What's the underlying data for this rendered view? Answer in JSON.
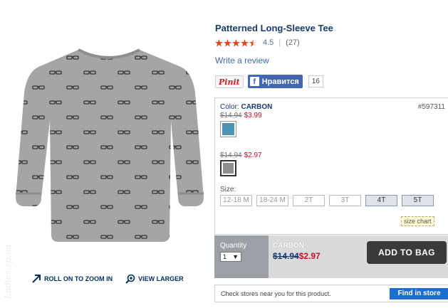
{
  "product": {
    "title": "Patterned Long-Sleeve Tee",
    "rating": "4.5",
    "review_count": "(27)",
    "rating_sep": "|",
    "write_review": "Write a review"
  },
  "social": {
    "pinit": "Pinit",
    "fb_icon": "f",
    "fb_like": "Нравится",
    "fb_count": "16"
  },
  "options": {
    "color_prefix": "Color:",
    "color_name": "CARBON",
    "sku": "#597311",
    "variant1": {
      "old_price": "$14.94",
      "new_price": "$3.99",
      "swatch_color": "#4f93b5"
    },
    "variant2": {
      "old_price": "$14.94",
      "new_price": "$2.97",
      "swatch_color": "#8e8e8e"
    },
    "size_label": "Size:",
    "sizes": [
      {
        "label": "12-18 M",
        "available": false
      },
      {
        "label": "18-24 M",
        "available": false
      },
      {
        "label": "2T",
        "available": false
      },
      {
        "label": "3T",
        "available": false
      },
      {
        "label": "4T",
        "available": true
      },
      {
        "label": "5T",
        "available": true
      }
    ],
    "size_chart": "size chart"
  },
  "bag": {
    "quantity_label": "Quantity",
    "quantity_value": "1",
    "color": "CARBON",
    "old_price": "$14.94",
    "new_price": "$2.97",
    "add_button": "ADD TO BAG"
  },
  "stores": {
    "text": "Check stores near you for this product.",
    "button": "Find in store"
  },
  "image_links": {
    "zoom": "ROLL ON TO ZOOM IN",
    "larger": "VIEW LARGER"
  },
  "watermark": "Ladies.zp.ua",
  "colors": {
    "accent_red": "#c8102e",
    "link_blue": "#3d6bb3",
    "button_blue": "#1d6fcf",
    "title_navy": "#1a3a6b"
  },
  "icons": [
    "star-icon",
    "zoom-arrow-icon",
    "magnifier-plus-icon",
    "facebook-icon",
    "dropdown-arrow-icon"
  ]
}
